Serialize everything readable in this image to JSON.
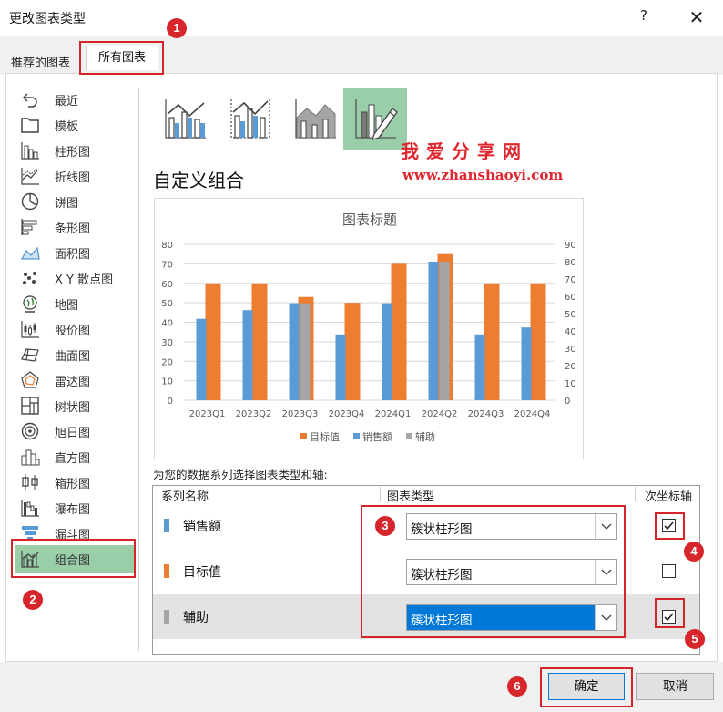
{
  "window": {
    "title": "更改图表类型",
    "help": "?",
    "close": "✕"
  },
  "tabs": [
    {
      "label": "推荐的图表"
    },
    {
      "label": "所有图表"
    }
  ],
  "sidebar": {
    "items": [
      {
        "label": "最近",
        "icon": "undo-icon"
      },
      {
        "label": "模板",
        "icon": "folder-icon"
      },
      {
        "label": "柱形图",
        "icon": "column-chart-icon"
      },
      {
        "label": "折线图",
        "icon": "line-chart-icon"
      },
      {
        "label": "饼图",
        "icon": "pie-chart-icon"
      },
      {
        "label": "条形图",
        "icon": "bar-chart-icon"
      },
      {
        "label": "面积图",
        "icon": "area-chart-icon"
      },
      {
        "label": "X Y 散点图",
        "icon": "scatter-chart-icon"
      },
      {
        "label": "地图",
        "icon": "map-chart-icon"
      },
      {
        "label": "股价图",
        "icon": "stock-chart-icon"
      },
      {
        "label": "曲面图",
        "icon": "surface-chart-icon"
      },
      {
        "label": "雷达图",
        "icon": "radar-chart-icon"
      },
      {
        "label": "树状图",
        "icon": "treemap-chart-icon"
      },
      {
        "label": "旭日图",
        "icon": "sunburst-chart-icon"
      },
      {
        "label": "直方图",
        "icon": "histogram-chart-icon"
      },
      {
        "label": "箱形图",
        "icon": "box-whisker-chart-icon"
      },
      {
        "label": "瀑布图",
        "icon": "waterfall-chart-icon"
      },
      {
        "label": "漏斗图",
        "icon": "funnel-chart-icon"
      },
      {
        "label": "组合图",
        "icon": "combo-chart-icon",
        "selected": true
      }
    ]
  },
  "subtypes": [
    {
      "name": "clustered-column-line",
      "icon": "combo-column-line-icon"
    },
    {
      "name": "clustered-column-line-secondary",
      "icon": "combo-column-line-secondary-icon"
    },
    {
      "name": "stacked-area-clustered-column",
      "icon": "combo-area-column-icon"
    },
    {
      "name": "custom-combination",
      "icon": "custom-combo-icon",
      "selected": true
    }
  ],
  "watermark": {
    "line1": "我爱分享网",
    "line2": "www.zhanshaoyi.com"
  },
  "section_title": "自定义组合",
  "chart_data": {
    "type": "bar",
    "title": "图表标题",
    "categories": [
      "2023Q1",
      "2023Q2",
      "2023Q3",
      "2023Q4",
      "2024Q1",
      "2024Q2",
      "2024Q3",
      "2024Q4"
    ],
    "series": [
      {
        "name": "目标值",
        "axis": "primary",
        "color": "#ed7d31",
        "values": [
          60,
          60,
          53,
          50,
          70,
          75,
          60,
          60
        ]
      },
      {
        "name": "销售额",
        "axis": "secondary",
        "color": "#5b9bd5",
        "values": [
          47,
          52,
          56,
          38,
          56,
          80,
          38,
          42
        ]
      },
      {
        "name": "辅助",
        "axis": "secondary",
        "color": "#a5a5a5",
        "values": [
          0,
          0,
          56,
          0,
          0,
          80,
          0,
          0
        ]
      }
    ],
    "y_primary": {
      "ticks": [
        "0",
        "10",
        "20",
        "30",
        "40",
        "50",
        "60",
        "70",
        "80"
      ],
      "min": 0,
      "max": 80
    },
    "y_secondary": {
      "ticks": [
        "0",
        "10",
        "20",
        "30",
        "40",
        "50",
        "60",
        "70",
        "80",
        "90"
      ],
      "min": 0,
      "max": 90
    },
    "legend": {
      "position": "bottom",
      "order": [
        "目标值",
        "销售额",
        "辅助"
      ]
    },
    "grid": true
  },
  "series_section": {
    "instruction": "为您的数据系列选择图表类型和轴:",
    "headers": {
      "name": "系列名称",
      "type": "图表类型",
      "secondary": "次坐标轴"
    },
    "rows": [
      {
        "name": "销售额",
        "color": "#5b9bd5",
        "type": "簇状柱形图",
        "secondary": true
      },
      {
        "name": "目标值",
        "color": "#ed7d31",
        "type": "簇状柱形图",
        "secondary": false
      },
      {
        "name": "辅助",
        "color": "#a5a5a5",
        "type": "簇状柱形图",
        "secondary": true,
        "focused": true
      }
    ]
  },
  "badges": [
    "1",
    "2",
    "3",
    "4",
    "5",
    "6"
  ],
  "buttons": {
    "ok": "确定",
    "cancel": "取消"
  }
}
